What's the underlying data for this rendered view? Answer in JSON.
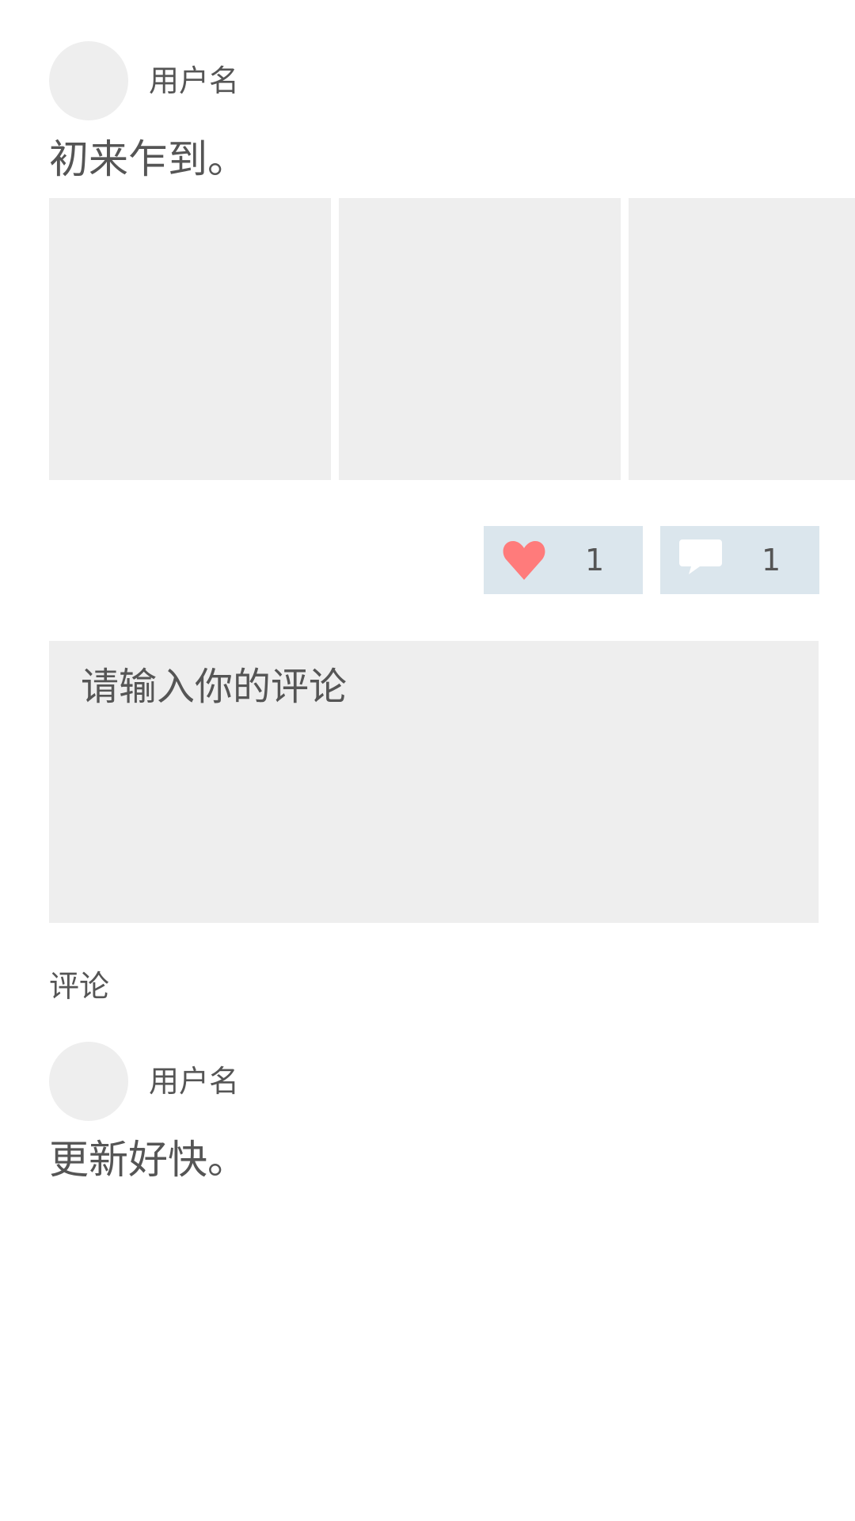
{
  "post": {
    "username": "用户名",
    "text": "初来乍到。",
    "images": [
      {
        "name": "image-1"
      },
      {
        "name": "image-2"
      },
      {
        "name": "image-3"
      }
    ],
    "like": {
      "icon": "heart-icon",
      "count": "1",
      "color": "#ff7b7b"
    },
    "comment": {
      "icon": "speech-bubble-icon",
      "count": "1",
      "color": "#ffffff"
    },
    "button_bg": "#dbe6ed"
  },
  "comment_input": {
    "placeholder": "请输入你的评论",
    "value": ""
  },
  "comments_section": {
    "title": "评论",
    "items": [
      {
        "username": "用户名",
        "text": "更新好快。"
      }
    ]
  }
}
